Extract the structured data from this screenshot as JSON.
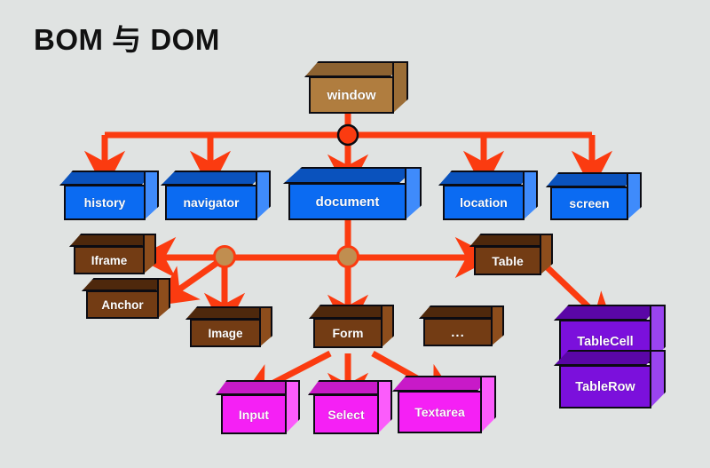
{
  "title": "BOM 与 DOM",
  "background_color": "#e0e3e2",
  "palette": {
    "arrow": "#fb3b10",
    "window_box": "#b07d3f",
    "bom_box": "#0b6bf2",
    "dom_box": "#733c14",
    "form_control_box": "#f520f5",
    "table_part_box": "#7b10dc",
    "junction_red": "#fb3b10",
    "junction_tan": "#c08e50",
    "text": "#ffffff",
    "outline": "#0b0b12"
  },
  "nodes": {
    "window": {
      "label": "window",
      "kind": "window_box"
    },
    "history": {
      "label": "history",
      "kind": "bom_box"
    },
    "navigator": {
      "label": "navigator",
      "kind": "bom_box"
    },
    "document": {
      "label": "document",
      "kind": "bom_box"
    },
    "location": {
      "label": "location",
      "kind": "bom_box"
    },
    "screen": {
      "label": "screen",
      "kind": "bom_box"
    },
    "iframe": {
      "label": "Iframe",
      "kind": "dom_box"
    },
    "anchor": {
      "label": "Anchor",
      "kind": "dom_box"
    },
    "image": {
      "label": "Image",
      "kind": "dom_box"
    },
    "form": {
      "label": "Form",
      "kind": "dom_box"
    },
    "ellipsis": {
      "label": "...",
      "kind": "dom_box"
    },
    "table": {
      "label": "Table",
      "kind": "dom_box"
    },
    "input": {
      "label": "Input",
      "kind": "form_control_box"
    },
    "select": {
      "label": "Select",
      "kind": "form_control_box"
    },
    "textarea": {
      "label": "Textarea",
      "kind": "form_control_box"
    },
    "tablecell": {
      "label": "TableCell",
      "kind": "table_part_box"
    },
    "tablerow": {
      "label": "TableRow",
      "kind": "table_part_box"
    }
  },
  "edges": [
    {
      "from": "window",
      "to": "history"
    },
    {
      "from": "window",
      "to": "navigator"
    },
    {
      "from": "window",
      "to": "document"
    },
    {
      "from": "window",
      "to": "location"
    },
    {
      "from": "window",
      "to": "screen"
    },
    {
      "from": "document",
      "to": "iframe"
    },
    {
      "from": "document",
      "to": "anchor"
    },
    {
      "from": "document",
      "to": "image"
    },
    {
      "from": "document",
      "to": "form"
    },
    {
      "from": "document",
      "to": "table"
    },
    {
      "from": "form",
      "to": "input"
    },
    {
      "from": "form",
      "to": "select"
    },
    {
      "from": "form",
      "to": "textarea"
    },
    {
      "from": "table",
      "to": "tablecell"
    }
  ],
  "junctions": [
    {
      "name": "window-junction",
      "color": "#fb3b10"
    },
    {
      "name": "document-junction",
      "color": "#c08e50"
    },
    {
      "name": "dom-branch-junction",
      "color": "#c08e50"
    }
  ]
}
